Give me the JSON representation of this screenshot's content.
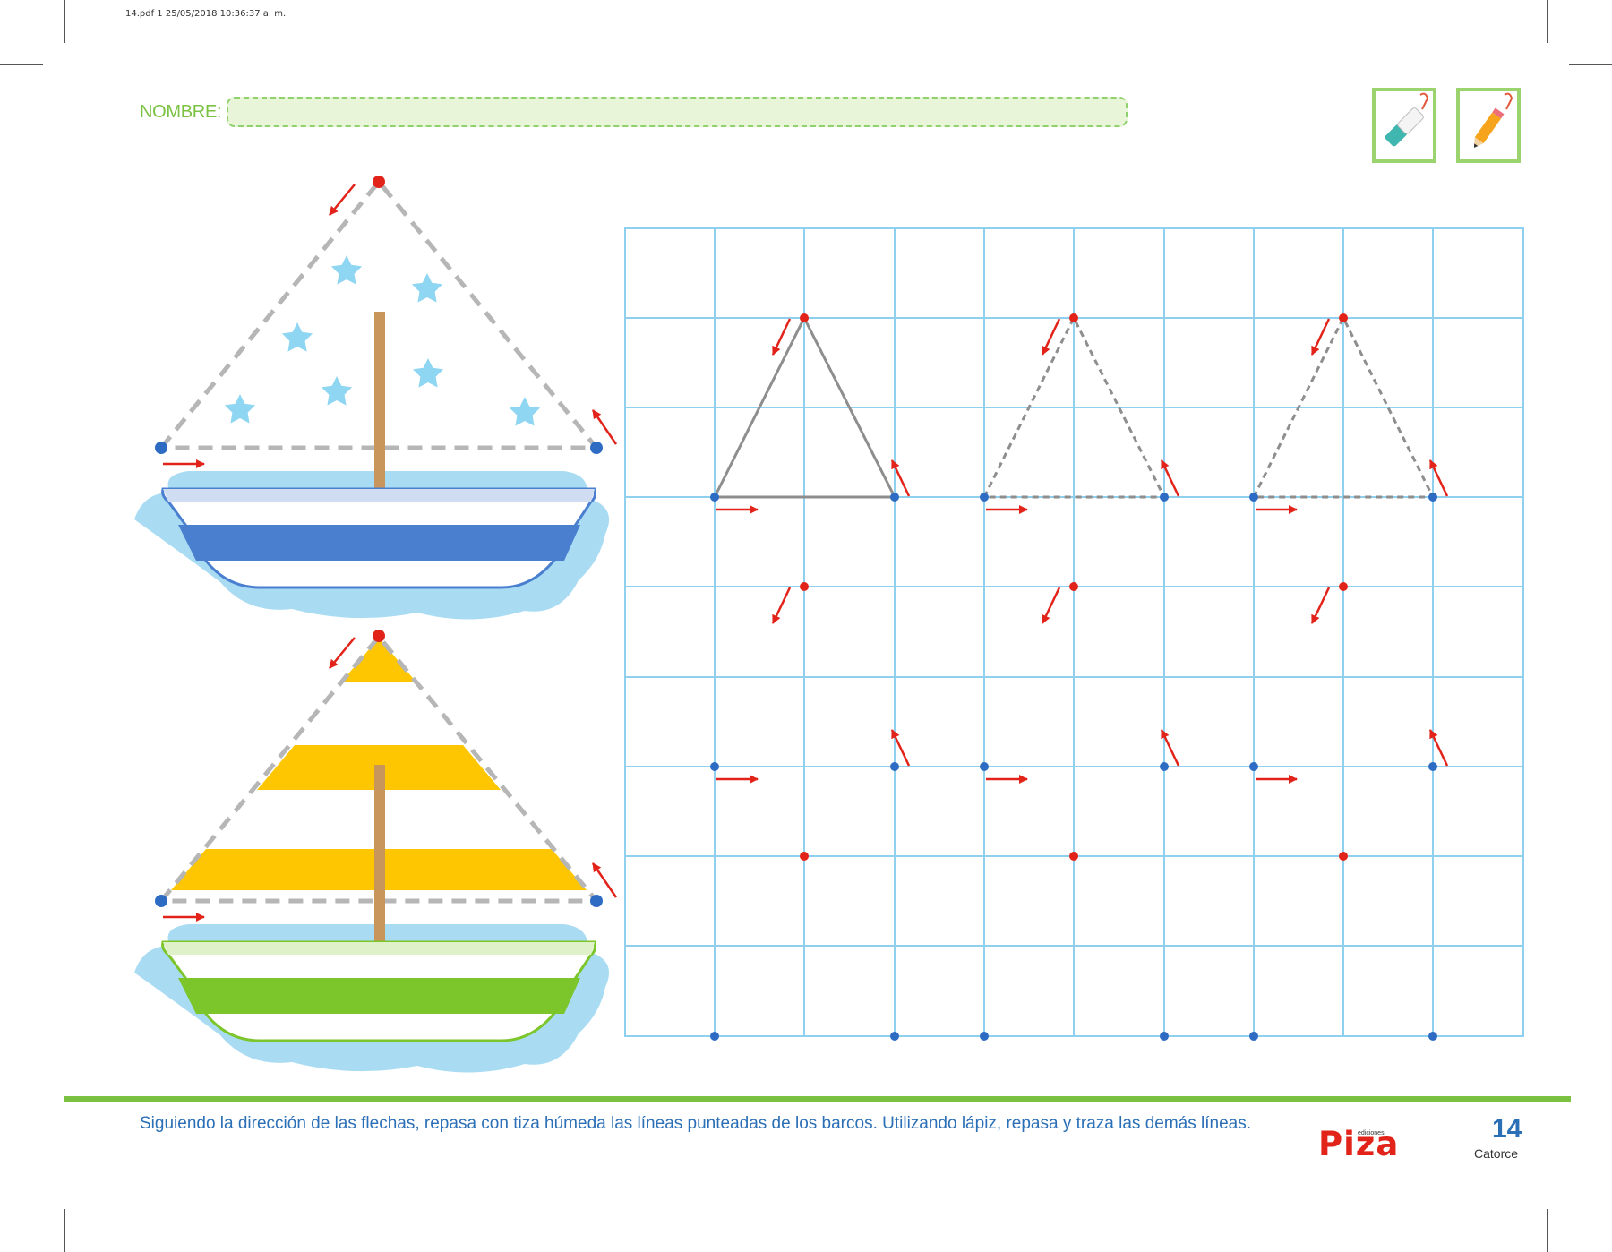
{
  "print_meta": "14.pdf   1   25/05/2018   10:36:37 a. m.",
  "header": {
    "name_label": "NOMBRE:",
    "name_value": ""
  },
  "tools": [
    {
      "name": "chalk-icon"
    },
    {
      "name": "pencil-icon"
    }
  ],
  "colors": {
    "green": "#7bc142",
    "blue_text": "#2b6fb6",
    "grid": "#8fd0ee",
    "red_dot": "#e2231a",
    "blue_dot": "#2e6cc4",
    "sail_yellow": "#fdc600",
    "star_blue": "#8fd6f3",
    "hull_blue": "#4a7fd0",
    "hull_green": "#7cc52a"
  },
  "footer": {
    "instruction": "Siguiendo la dirección de las flechas, repasa con tiza húmeda las líneas punteadas de los barcos. Utilizando lápiz, repasa y traza las demás líneas.",
    "brand_small": "ediciones",
    "brand": "Piza",
    "page_number": "14",
    "page_word": "Catorce"
  }
}
